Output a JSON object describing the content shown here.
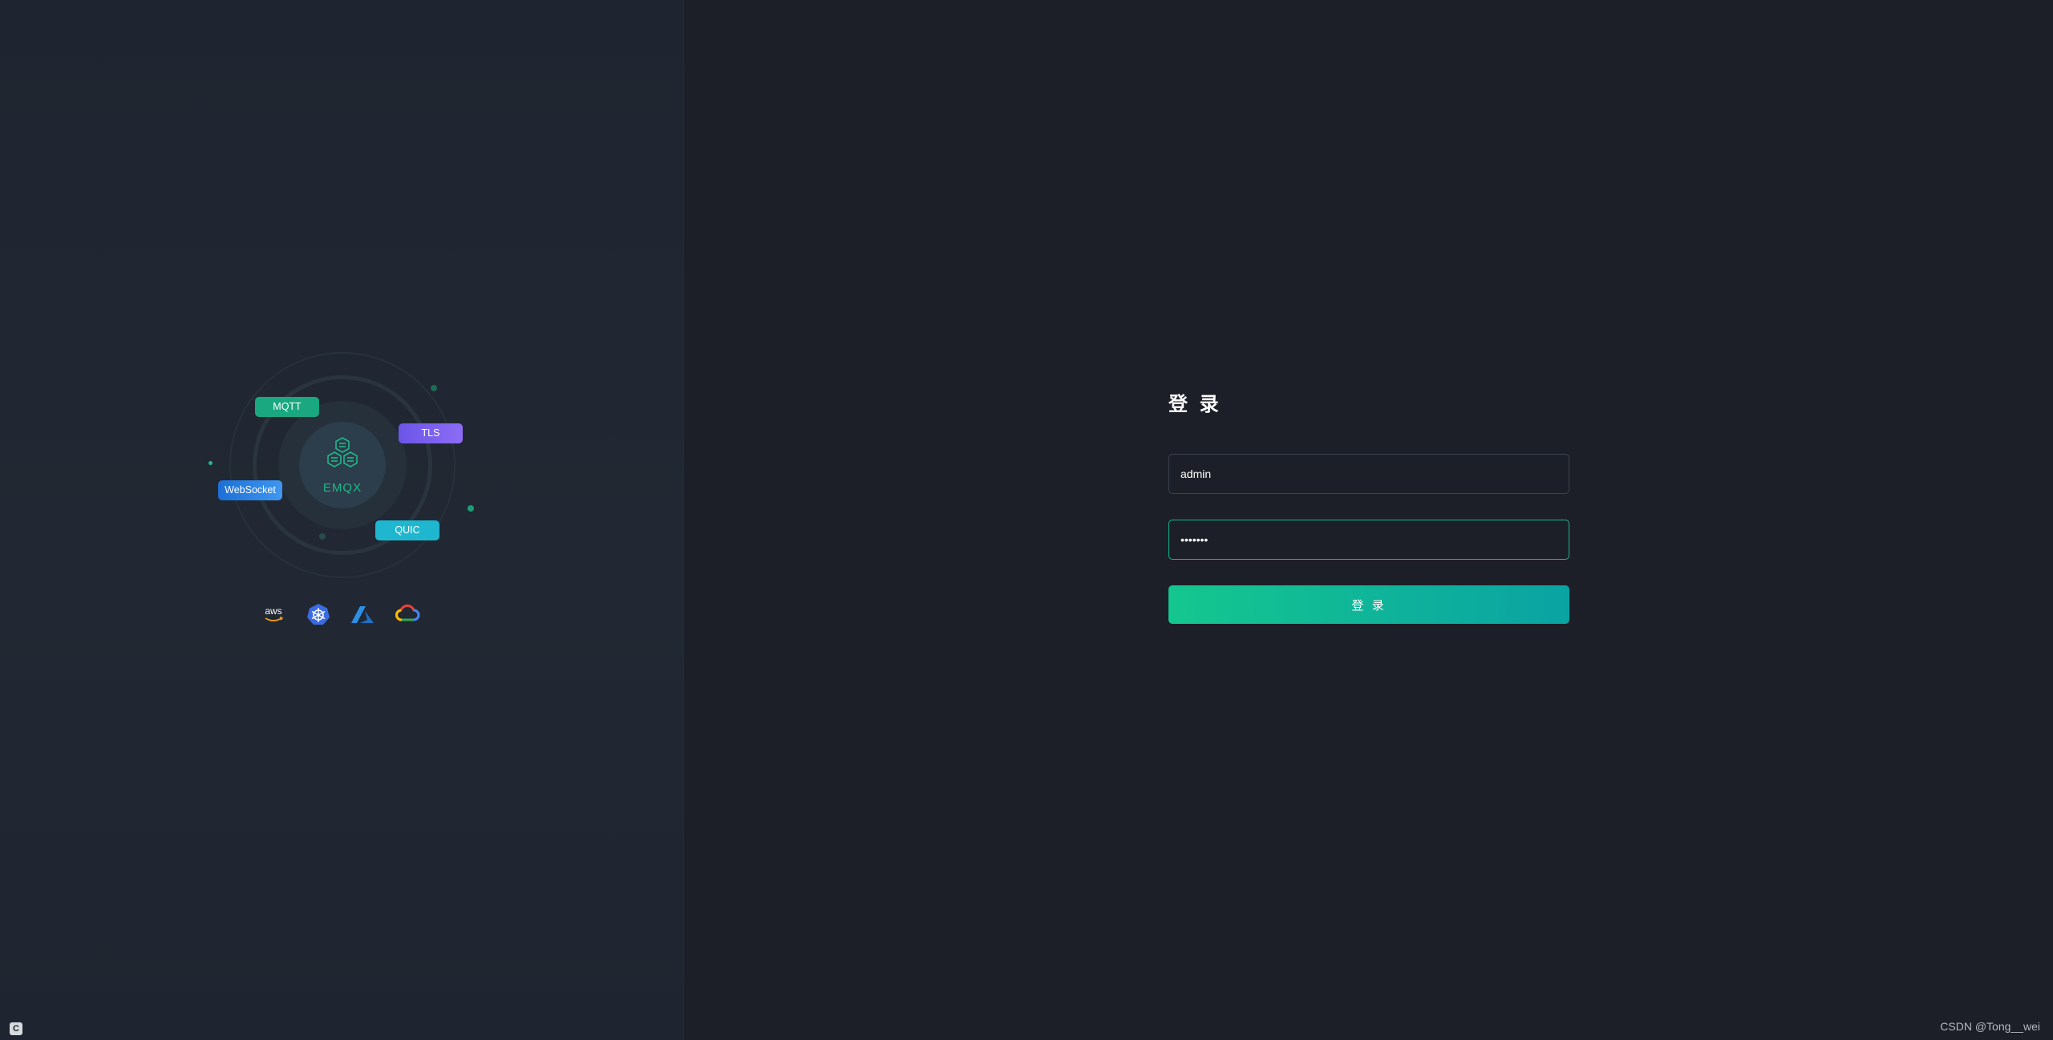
{
  "illustration": {
    "hub_label": "EMQX",
    "tags": {
      "mqtt": "MQTT",
      "tls": "TLS",
      "websocket": "WebSocket",
      "quic": "QUIC"
    },
    "cloud_icons": [
      "aws-icon",
      "kubernetes-icon",
      "azure-icon",
      "google-cloud-icon"
    ],
    "cloud_labels": {
      "aws": "aws"
    }
  },
  "login": {
    "title": "登 录",
    "username_value": "admin",
    "password_value": "public1",
    "button_label": "登 录"
  },
  "footer": {
    "watermark": "CSDN @Tong__wei",
    "corner_badge": "C"
  },
  "colors": {
    "accent": "#14c78e",
    "accent_end": "#0aa3a3",
    "background": "#1c1f27",
    "panel": "#212833"
  }
}
